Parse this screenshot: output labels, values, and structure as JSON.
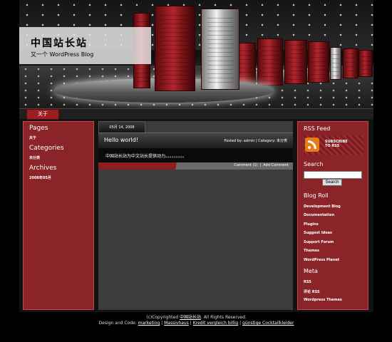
{
  "header": {
    "site_title": "中国站长站",
    "site_subtitle": "又一个 WordPress Blog"
  },
  "nav": {
    "tabs": [
      {
        "label": "关于"
      }
    ]
  },
  "left_sidebar": {
    "pages_heading": "Pages",
    "pages_items": [
      "关于"
    ],
    "categories_heading": "Categories",
    "categories_items": [
      "未分类"
    ],
    "archives_heading": "Archives",
    "archives_items": [
      "2008年05月"
    ]
  },
  "post": {
    "date": "05月 14, 2008",
    "title": "Hello world!",
    "meta": "Posted by: admin  |  Category: 未分类",
    "body": "中国站长站为中文站长提供动力。。。。。。。。。",
    "comments_label": "Comment (1)",
    "separator": "|",
    "add_comment_label": "Add Comment"
  },
  "right_sidebar": {
    "rss_heading": "RSS Feed",
    "rss_label": "SUBSCRIBE TO RSS",
    "search_heading": "Search",
    "search_value": "",
    "search_button": "Search",
    "blogroll_heading": "Blog Roll",
    "blogroll_items": [
      "Development Blog",
      "Documentation",
      "Plugins",
      "Suggest Ideas",
      "Support Forum",
      "Themes",
      "WordPress Planet"
    ],
    "meta_heading": "Meta",
    "meta_items": [
      "RSS",
      "评论 RSS",
      "Wordpress Themes"
    ]
  },
  "footer": {
    "copyright_prefix": "(c)Copyrighted",
    "copyright_link": "中国站长站",
    "copyright_suffix": ". All Rights Reserved.",
    "design_prefix": "Design and Code:",
    "links": [
      "marketing",
      "Massivhaus",
      "Kredit vergleich billig",
      "günstige Cocktailkleider"
    ],
    "separator": "|"
  },
  "colors": {
    "sidebar": "#8b2428",
    "accent": "#9b1e22",
    "main_bg": "#3c3c3c",
    "rss": "#e67b1a"
  }
}
